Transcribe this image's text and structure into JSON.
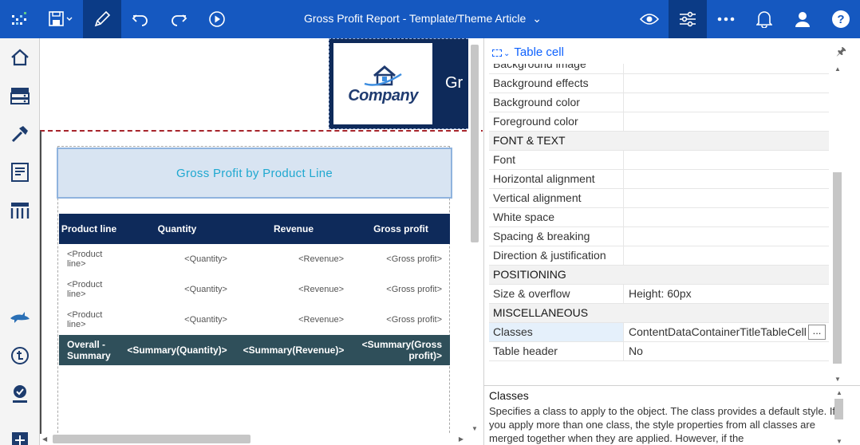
{
  "header": {
    "title": "Gross Profit Report - Template/Theme Article"
  },
  "report": {
    "logo_text": "Company",
    "header_partial": "Gr",
    "section_title": "Gross Profit by Product Line",
    "columns": [
      "Product line",
      "Quantity",
      "Revenue",
      "Gross profit"
    ],
    "rows": [
      [
        "<Product line>",
        "<Quantity>",
        "<Revenue>",
        "<Gross profit>"
      ],
      [
        "<Product line>",
        "<Quantity>",
        "<Revenue>",
        "<Gross profit>"
      ],
      [
        "<Product line>",
        "<Quantity>",
        "<Revenue>",
        "<Gross profit>"
      ]
    ],
    "summary": [
      "Overall - Summary",
      "<Summary(Quantity)>",
      "<Summary(Revenue)>",
      "<Summary(Gross profit)>"
    ]
  },
  "properties": {
    "selection_label": "Table cell",
    "rows": [
      {
        "key": "Background image",
        "value": "",
        "type": "prop"
      },
      {
        "key": "Background effects",
        "value": "",
        "type": "prop"
      },
      {
        "key": "Background color",
        "value": "",
        "type": "prop"
      },
      {
        "key": "Foreground color",
        "value": "",
        "type": "prop"
      },
      {
        "key": "FONT & TEXT",
        "value": "",
        "type": "section"
      },
      {
        "key": "Font",
        "value": "",
        "type": "prop"
      },
      {
        "key": "Horizontal alignment",
        "value": "",
        "type": "prop"
      },
      {
        "key": "Vertical alignment",
        "value": "",
        "type": "prop"
      },
      {
        "key": "White space",
        "value": "",
        "type": "prop"
      },
      {
        "key": "Spacing & breaking",
        "value": "",
        "type": "prop"
      },
      {
        "key": "Direction & justification",
        "value": "",
        "type": "prop"
      },
      {
        "key": "POSITIONING",
        "value": "",
        "type": "section"
      },
      {
        "key": "Size & overflow",
        "value": "Height: 60px",
        "type": "prop"
      },
      {
        "key": "MISCELLANEOUS",
        "value": "",
        "type": "section"
      },
      {
        "key": "Classes",
        "value": "ContentDataContainerTitleTableCell",
        "type": "selected"
      },
      {
        "key": "Table header",
        "value": "No",
        "type": "prop"
      }
    ],
    "more_button": "...",
    "description_title": "Classes",
    "description_text": "Specifies a class to apply to the object. The class provides a default style. If you apply more than one class, the style properties from all classes are merged together when they are applied. However, if the"
  }
}
